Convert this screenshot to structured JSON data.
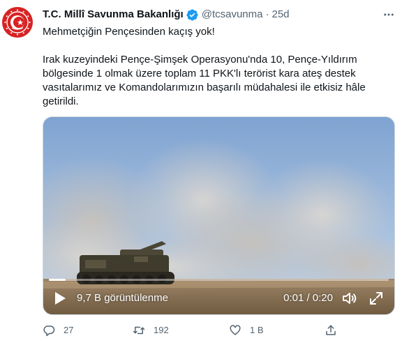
{
  "tweet": {
    "author_name": "T.C. Millî Savunma Bakanlığı",
    "handle": "@tcsavunma",
    "separator": "·",
    "time": "25d",
    "paragraph1": "Mehmetçiğin Pençesinden kaçış yok!",
    "paragraph2": "Irak kuzeyindeki Pençe-Şimşek Operasyonu'nda 10, Pençe-Yıldırım bölgesinde 1 olmak üzere toplam 11 PKK'lı terörist kara ateş destek vasıtalarımız ve Komandolarımızın başarılı müdahalesi ile etkisiz hâle getirildi."
  },
  "video": {
    "views": "9,7 B görüntülenme",
    "timer": "0:01 / 0:20",
    "progress_fraction": 0.05
  },
  "actions": {
    "reply_count": "27",
    "retweet_count": "192",
    "like_count": "1 B"
  },
  "colors": {
    "verified": "#1d9bf0",
    "secondary_text": "#536471",
    "avatar_red": "#d72323"
  }
}
